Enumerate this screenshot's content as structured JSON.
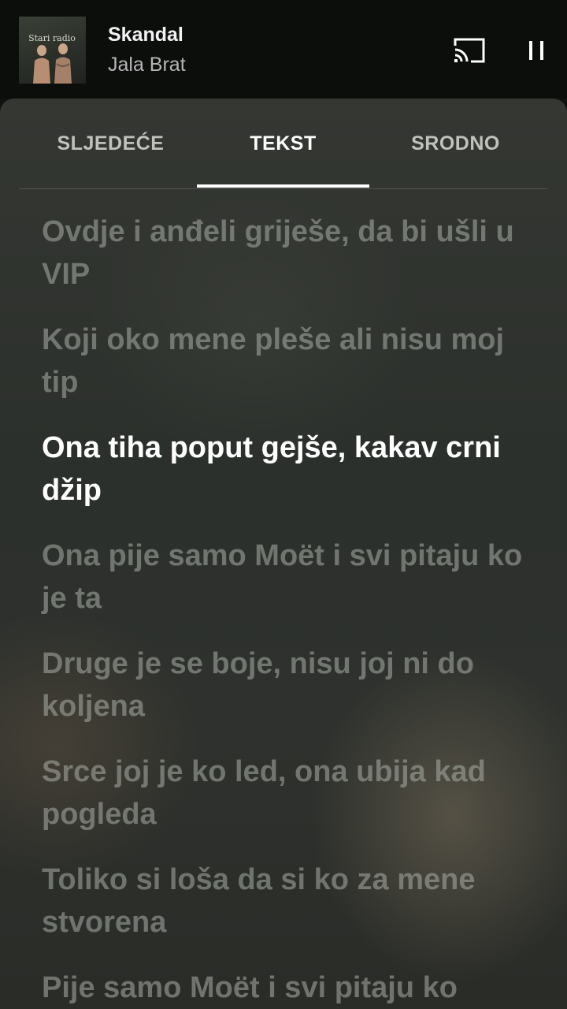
{
  "now_playing": {
    "title": "Skandal",
    "artist": "Jala Brat",
    "album_art_text": "Stari radio"
  },
  "controls": {
    "cast_icon": "cast-icon",
    "pause_icon": "pause-icon"
  },
  "tabs": [
    {
      "label": "SLJEDEĆE",
      "active": false
    },
    {
      "label": "TEKST",
      "active": true
    },
    {
      "label": "SRODNO",
      "active": false
    }
  ],
  "lyrics": [
    {
      "text": "Ovdje i anđeli griješe, da bi ušli u VIP",
      "current": false
    },
    {
      "text": "Koji oko mene pleše ali nisu moj tip",
      "current": false
    },
    {
      "text": "Ona tiha poput gejše, kakav crni džip",
      "current": true
    },
    {
      "text": "Ona pije samo Moët i svi pitaju ko je ta",
      "current": false
    },
    {
      "text": "Druge je se boje, nisu joj ni do koljena",
      "current": false
    },
    {
      "text": "Srce joj je ko led, ona ubija kad pogleda",
      "current": false
    },
    {
      "text": "Toliko si loša da si ko za mene stvorena",
      "current": false
    },
    {
      "text": "Pije samo Moët i svi pitaju ko",
      "current": false
    }
  ],
  "colors": {
    "miniplayer_bg": "#0c0e0c",
    "sheet_bg": "#2e312d",
    "active_text": "#ffffff",
    "inactive_lyric": "#aaaea8"
  }
}
